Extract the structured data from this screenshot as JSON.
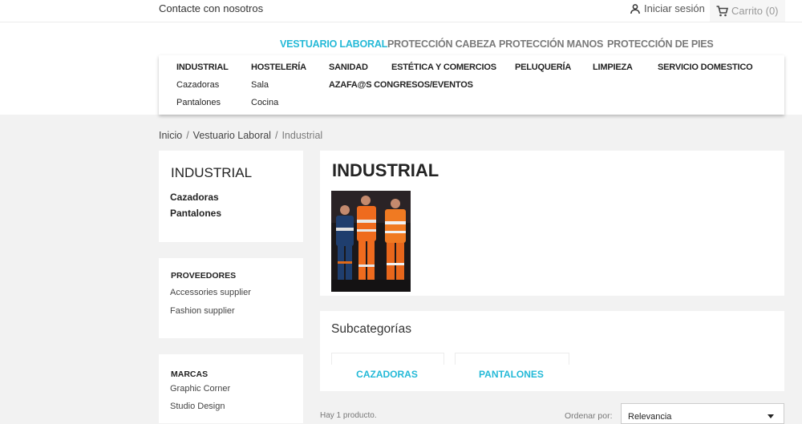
{
  "topbar": {
    "contact": "Contacte con nosotros",
    "login": "Iniciar sesión",
    "cart": "Carrito (0)"
  },
  "nav": [
    "VESTUARIO LABORAL",
    "PROTECCIÓN CABEZA",
    "PROTECCIÓN MANOS",
    "PROTECCIÓN DE PIES"
  ],
  "mega": {
    "industrial": "INDUSTRIAL",
    "industrial_items": [
      "Cazadoras",
      "Pantalones"
    ],
    "hosteleria": "HOSTELERÍA",
    "hosteleria_items": [
      "Sala",
      "Cocina"
    ],
    "sanidad": "SANIDAD",
    "azafatas": "AZAFA@S CONGRESOS/EVENTOS",
    "estetica": "ESTÉTICA Y COMERCIOS",
    "peluqueria": "PELUQUERÍA",
    "limpieza": "LIMPIEZA",
    "servicio": "SERVICIO DOMESTICO"
  },
  "breadcrumb": [
    "Inicio",
    "Vestuario Laboral",
    "Industrial"
  ],
  "sidebar": {
    "category_title": "INDUSTRIAL",
    "category_links": [
      "Cazadoras",
      "Pantalones"
    ],
    "suppliers_title": "PROVEEDORES",
    "suppliers": [
      "Accessories supplier",
      "Fashion supplier"
    ],
    "brands_title": "MARCAS",
    "brands": [
      "Graphic Corner",
      "Studio Design"
    ]
  },
  "main": {
    "title": "INDUSTRIAL",
    "subcategories_title": "Subcategorías",
    "subcategories": [
      "CAZADORAS",
      "PANTALONES"
    ],
    "product_count": "Hay 1 producto.",
    "sort_label": "Ordenar por:",
    "sort_value": "Relevancia"
  },
  "colors": {
    "accent": "#24b9d7"
  }
}
